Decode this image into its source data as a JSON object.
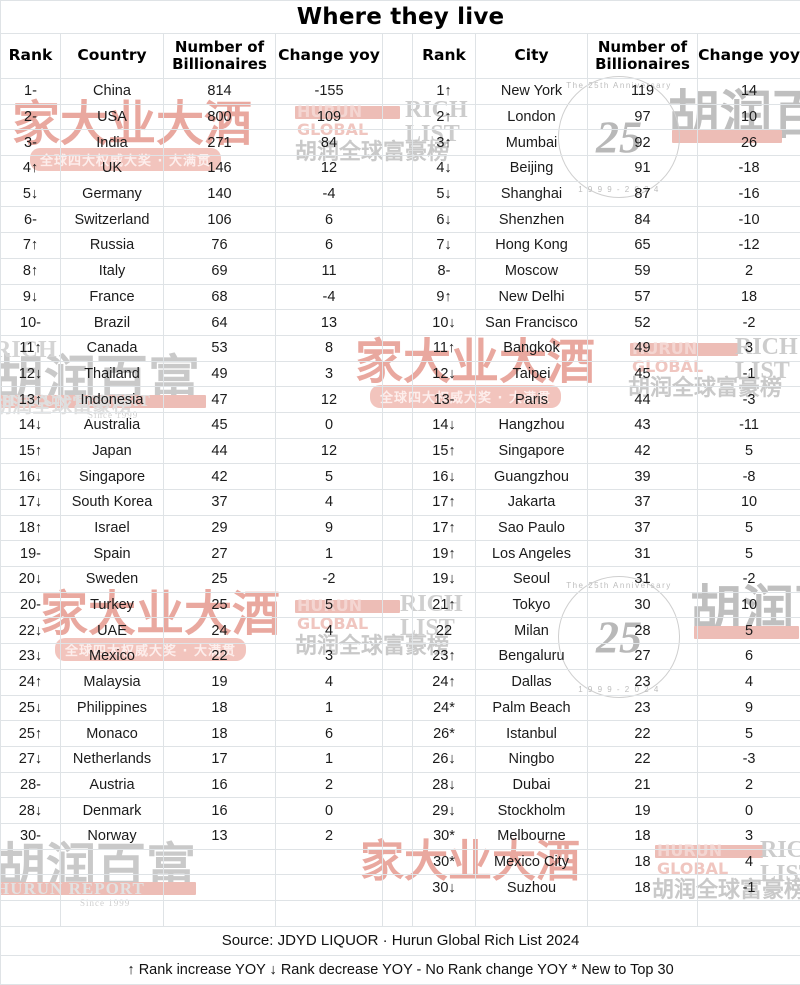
{
  "title": "Where they live",
  "headers": {
    "rank": "Rank",
    "country": "Country",
    "city": "City",
    "number": "Number of Billionaires",
    "number_l1": "Number of",
    "number_l2": "Billionaires",
    "change": "Change yoy"
  },
  "footer": {
    "source": "Source: JDYD LIQUOR · Hurun Global Rich List 2024",
    "legend": "↑ Rank increase YOY ↓ Rank decrease YOY - No Rank change YOY * New to Top 30"
  },
  "watermarks": {
    "red_brand_cn": "家大业大酒",
    "red_pill_cn": "全球四大权威大奖 · 大满贯",
    "grey_hurun_cn": "胡润百富",
    "grey_hurun_global_cn": "胡润全球富豪榜",
    "grey_rich": "RICH",
    "grey_list": "LIST",
    "pink_hurun": "HURUN",
    "pink_global": "GLOBAL",
    "hurun_report": "HURUN REPORT",
    "since": "Since 1999",
    "ring_top": "The 25th Anniversary",
    "ring_bottom": "1 9 9 9 - 2 0 2 4",
    "ring_mark": "25"
  },
  "colors": {
    "grid": "#dfe3e6",
    "text": "#1b1b1b",
    "watermark_red": "#e9a89f",
    "watermark_grey": "#c9c9c9"
  },
  "countries": [
    {
      "rank": "1-",
      "name": "China",
      "num": "814",
      "chg": "-155"
    },
    {
      "rank": "2-",
      "name": "USA",
      "num": "800",
      "chg": "109"
    },
    {
      "rank": "3-",
      "name": "India",
      "num": "271",
      "chg": "84"
    },
    {
      "rank": "4↑",
      "name": "UK",
      "num": "146",
      "chg": "12"
    },
    {
      "rank": "5↓",
      "name": "Germany",
      "num": "140",
      "chg": "-4"
    },
    {
      "rank": "6-",
      "name": "Switzerland",
      "num": "106",
      "chg": "6"
    },
    {
      "rank": "7↑",
      "name": "Russia",
      "num": "76",
      "chg": "6"
    },
    {
      "rank": "8↑",
      "name": "Italy",
      "num": "69",
      "chg": "11"
    },
    {
      "rank": "9↓",
      "name": "France",
      "num": "68",
      "chg": "-4"
    },
    {
      "rank": "10-",
      "name": "Brazil",
      "num": "64",
      "chg": "13"
    },
    {
      "rank": "11↑",
      "name": "Canada",
      "num": "53",
      "chg": "8"
    },
    {
      "rank": "12↓",
      "name": "Thailand",
      "num": "49",
      "chg": "3"
    },
    {
      "rank": "13↑",
      "name": "Indonesia",
      "num": "47",
      "chg": "12"
    },
    {
      "rank": "14↓",
      "name": "Australia",
      "num": "45",
      "chg": "0"
    },
    {
      "rank": "15↑",
      "name": "Japan",
      "num": "44",
      "chg": "12"
    },
    {
      "rank": "16↓",
      "name": "Singapore",
      "num": "42",
      "chg": "5"
    },
    {
      "rank": "17↓",
      "name": "South Korea",
      "num": "37",
      "chg": "4"
    },
    {
      "rank": "18↑",
      "name": "Israel",
      "num": "29",
      "chg": "9"
    },
    {
      "rank": "19-",
      "name": "Spain",
      "num": "27",
      "chg": "1"
    },
    {
      "rank": "20↓",
      "name": "Sweden",
      "num": "25",
      "chg": "-2"
    },
    {
      "rank": "20-",
      "name": "Turkey",
      "num": "25",
      "chg": "5"
    },
    {
      "rank": "22↓",
      "name": "UAE",
      "num": "24",
      "chg": "4"
    },
    {
      "rank": "23↓",
      "name": "Mexico",
      "num": "22",
      "chg": "3"
    },
    {
      "rank": "24↑",
      "name": "Malaysia",
      "num": "19",
      "chg": "4"
    },
    {
      "rank": "25↓",
      "name": "Philippines",
      "num": "18",
      "chg": "1"
    },
    {
      "rank": "25↑",
      "name": "Monaco",
      "num": "18",
      "chg": "6"
    },
    {
      "rank": "27↓",
      "name": "Netherlands",
      "num": "17",
      "chg": "1"
    },
    {
      "rank": "28-",
      "name": "Austria",
      "num": "16",
      "chg": "2"
    },
    {
      "rank": "28↓",
      "name": "Denmark",
      "num": "16",
      "chg": "0"
    },
    {
      "rank": "30-",
      "name": "Norway",
      "num": "13",
      "chg": "2"
    },
    {
      "rank": "",
      "name": "",
      "num": "",
      "chg": ""
    },
    {
      "rank": "",
      "name": "",
      "num": "",
      "chg": ""
    },
    {
      "rank": "",
      "name": "",
      "num": "",
      "chg": ""
    }
  ],
  "cities": [
    {
      "rank": "1↑",
      "name": "New York",
      "num": "119",
      "chg": "14"
    },
    {
      "rank": "2↑",
      "name": "London",
      "num": "97",
      "chg": "10"
    },
    {
      "rank": "3↑",
      "name": "Mumbai",
      "num": "92",
      "chg": "26"
    },
    {
      "rank": "4↓",
      "name": "Beijing",
      "num": "91",
      "chg": "-18"
    },
    {
      "rank": "5↓",
      "name": "Shanghai",
      "num": "87",
      "chg": "-16"
    },
    {
      "rank": "6↓",
      "name": "Shenzhen",
      "num": "84",
      "chg": "-10"
    },
    {
      "rank": "7↓",
      "name": "Hong Kong",
      "num": "65",
      "chg": "-12"
    },
    {
      "rank": "8-",
      "name": "Moscow",
      "num": "59",
      "chg": "2"
    },
    {
      "rank": "9↑",
      "name": "New Delhi",
      "num": "57",
      "chg": "18"
    },
    {
      "rank": "10↓",
      "name": "San Francisco",
      "num": "52",
      "chg": "-2"
    },
    {
      "rank": "11↑",
      "name": "Bangkok",
      "num": "49",
      "chg": "3"
    },
    {
      "rank": "12↓",
      "name": "Taipei",
      "num": "45",
      "chg": "-1"
    },
    {
      "rank": "13-",
      "name": "Paris",
      "num": "44",
      "chg": "-3"
    },
    {
      "rank": "14↓",
      "name": "Hangzhou",
      "num": "43",
      "chg": "-11"
    },
    {
      "rank": "15↑",
      "name": "Singapore",
      "num": "42",
      "chg": "5"
    },
    {
      "rank": "16↓",
      "name": "Guangzhou",
      "num": "39",
      "chg": "-8"
    },
    {
      "rank": "17↑",
      "name": "Jakarta",
      "num": "37",
      "chg": "10"
    },
    {
      "rank": "17↑",
      "name": "Sao Paulo",
      "num": "37",
      "chg": "5"
    },
    {
      "rank": "19↑",
      "name": "Los Angeles",
      "num": "31",
      "chg": "5"
    },
    {
      "rank": "19↓",
      "name": "Seoul",
      "num": "31",
      "chg": "-2"
    },
    {
      "rank": "21↑",
      "name": "Tokyo",
      "num": "30",
      "chg": "10"
    },
    {
      "rank": "22",
      "name": "Milan",
      "num": "28",
      "chg": "5"
    },
    {
      "rank": "23↑",
      "name": "Bengaluru",
      "num": "27",
      "chg": "6"
    },
    {
      "rank": "24↑",
      "name": "Dallas",
      "num": "23",
      "chg": "4"
    },
    {
      "rank": "24*",
      "name": "Palm Beach",
      "num": "23",
      "chg": "9"
    },
    {
      "rank": "26*",
      "name": "Istanbul",
      "num": "22",
      "chg": "5"
    },
    {
      "rank": "26↓",
      "name": "Ningbo",
      "num": "22",
      "chg": "-3"
    },
    {
      "rank": "28↓",
      "name": "Dubai",
      "num": "21",
      "chg": "2"
    },
    {
      "rank": "29↓",
      "name": "Stockholm",
      "num": "19",
      "chg": "0"
    },
    {
      "rank": "30*",
      "name": "Melbourne",
      "num": "18",
      "chg": "3"
    },
    {
      "rank": "30*",
      "name": "Mexico City",
      "num": "18",
      "chg": "4"
    },
    {
      "rank": "30↓",
      "name": "Suzhou",
      "num": "18",
      "chg": "-1"
    },
    {
      "rank": "",
      "name": "",
      "num": "",
      "chg": ""
    }
  ]
}
